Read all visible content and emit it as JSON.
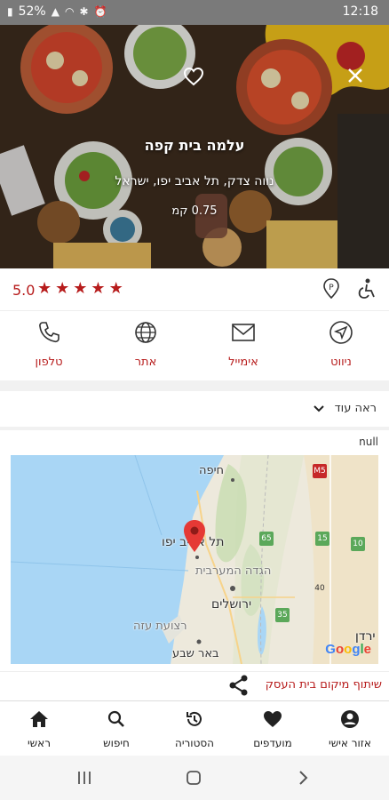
{
  "status_bar": {
    "battery": "52%",
    "time": "12:18"
  },
  "hero": {
    "title": "עלמה בית קפה",
    "address": "נווה צדק, תל אביב יפו, ישראל",
    "distance": "0.75 קמ"
  },
  "rating": {
    "value": "5.0",
    "stars": 5
  },
  "actions": [
    {
      "label": "ניווט",
      "icon": "navigate-icon"
    },
    {
      "label": "אימייל",
      "icon": "mail-icon"
    },
    {
      "label": "אתר",
      "icon": "globe-icon"
    },
    {
      "label": "טלפון",
      "icon": "phone-icon"
    }
  ],
  "see_more": {
    "label": "ראה עוד"
  },
  "null_text": "null",
  "map": {
    "cities": {
      "haifa": "חיפה",
      "tel_aviv": "תל אביב יפו",
      "west_bank": "הגדה המערבית",
      "jerusalem": "ירושלים",
      "gaza": "רצועת עזה",
      "beersheba": "באר שבע",
      "jordan": "ירדן"
    },
    "roads": [
      "M5",
      "65",
      "15",
      "10",
      "40",
      "35"
    ],
    "attribution": "Google"
  },
  "share": {
    "label": "שיתוף מיקום בית העסק"
  },
  "bottom_nav": [
    {
      "label": "אזור אישי",
      "icon": "account-icon"
    },
    {
      "label": "מועדפים",
      "icon": "heart-icon"
    },
    {
      "label": "הסטוריה",
      "icon": "history-icon"
    },
    {
      "label": "חיפוש",
      "icon": "search-icon"
    },
    {
      "label": "ראשי",
      "icon": "home-icon"
    }
  ],
  "colors": {
    "accent": "#b71c1c",
    "status_bar": "#7a7a7a"
  }
}
